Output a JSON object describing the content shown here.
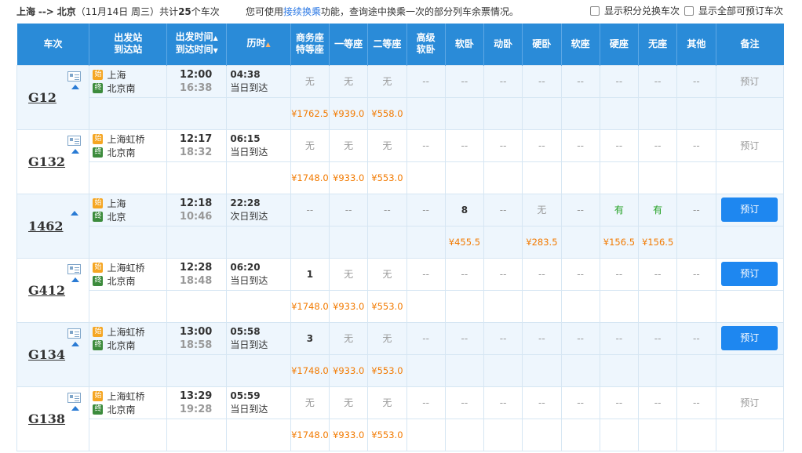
{
  "header": {
    "from": "上海",
    "arrow": "-->",
    "to": "北京",
    "date": "（11月14日  周三）",
    "total_prefix": "共计",
    "total_count": "25",
    "total_suffix": "个车次",
    "tip_before": "您可使用",
    "tip_link": "接续换乘",
    "tip_after": "功能，查询途中换乘一次的部分列车余票情况。",
    "opt_points": "显示积分兑换车次",
    "opt_all": "显示全部可预订车次"
  },
  "columns": {
    "train": "车次",
    "station_a": "出发站",
    "station_b": "到达站",
    "time_a": "出发时间",
    "time_b": "到达时间",
    "duration": "历时",
    "swz_a": "商务座",
    "swz_b": "特等座",
    "ydz": "一等座",
    "edz": "二等座",
    "gjrw_a": "高级",
    "gjrw_b": "软卧",
    "rw": "软卧",
    "dw": "动卧",
    "yw": "硬卧",
    "rz": "软座",
    "yz": "硬座",
    "wz": "无座",
    "qt": "其他",
    "remark": "备注"
  },
  "sort_up_icon": "▲",
  "sort_down_icon": "▼",
  "badge_start": "始",
  "badge_end": "终",
  "trains": [
    {
      "no": "G12",
      "from": "上海",
      "to": "北京南",
      "dep": "12:00",
      "arr": "16:38",
      "dur": "04:38",
      "day": "当日到达",
      "seats": [
        "无",
        "无",
        "无",
        "--",
        "--",
        "--",
        "--",
        "--",
        "--",
        "--",
        "--"
      ],
      "prices": [
        "¥1762.5",
        "¥939.0",
        "¥558.0",
        "",
        "",
        "",
        "",
        "",
        "",
        "",
        ""
      ],
      "book": "预订",
      "bookable": false
    },
    {
      "no": "G132",
      "from": "上海虹桥",
      "to": "北京南",
      "dep": "12:17",
      "arr": "18:32",
      "dur": "06:15",
      "day": "当日到达",
      "seats": [
        "无",
        "无",
        "无",
        "--",
        "--",
        "--",
        "--",
        "--",
        "--",
        "--",
        "--"
      ],
      "prices": [
        "¥1748.0",
        "¥933.0",
        "¥553.0",
        "",
        "",
        "",
        "",
        "",
        "",
        "",
        ""
      ],
      "book": "预订",
      "bookable": false
    },
    {
      "no": "1462",
      "from": "上海",
      "to": "北京",
      "dep": "12:18",
      "arr": "10:46",
      "dur": "22:28",
      "day": "次日到达",
      "seats": [
        "--",
        "--",
        "--",
        "--",
        "8",
        "--",
        "无",
        "--",
        "有",
        "有",
        "--"
      ],
      "prices": [
        "",
        "",
        "",
        "",
        "¥455.5",
        "",
        "¥283.5",
        "",
        "¥156.5",
        "¥156.5",
        ""
      ],
      "book": "预订",
      "bookable": true
    },
    {
      "no": "G412",
      "from": "上海虹桥",
      "to": "北京南",
      "dep": "12:28",
      "arr": "18:48",
      "dur": "06:20",
      "day": "当日到达",
      "seats": [
        "1",
        "无",
        "无",
        "--",
        "--",
        "--",
        "--",
        "--",
        "--",
        "--",
        "--"
      ],
      "prices": [
        "¥1748.0",
        "¥933.0",
        "¥553.0",
        "",
        "",
        "",
        "",
        "",
        "",
        "",
        ""
      ],
      "book": "预订",
      "bookable": true
    },
    {
      "no": "G134",
      "from": "上海虹桥",
      "to": "北京南",
      "dep": "13:00",
      "arr": "18:58",
      "dur": "05:58",
      "day": "当日到达",
      "seats": [
        "3",
        "无",
        "无",
        "--",
        "--",
        "--",
        "--",
        "--",
        "--",
        "--",
        "--"
      ],
      "prices": [
        "¥1748.0",
        "¥933.0",
        "¥553.0",
        "",
        "",
        "",
        "",
        "",
        "",
        "",
        ""
      ],
      "book": "预订",
      "bookable": true
    },
    {
      "no": "G138",
      "from": "上海虹桥",
      "to": "北京南",
      "dep": "13:29",
      "arr": "19:28",
      "dur": "05:59",
      "day": "当日到达",
      "seats": [
        "无",
        "无",
        "无",
        "--",
        "--",
        "--",
        "--",
        "--",
        "--",
        "--",
        "--"
      ],
      "prices": [
        "¥1748.0",
        "¥933.0",
        "¥553.0",
        "",
        "",
        "",
        "",
        "",
        "",
        "",
        ""
      ],
      "book": "预订",
      "bookable": false
    }
  ]
}
